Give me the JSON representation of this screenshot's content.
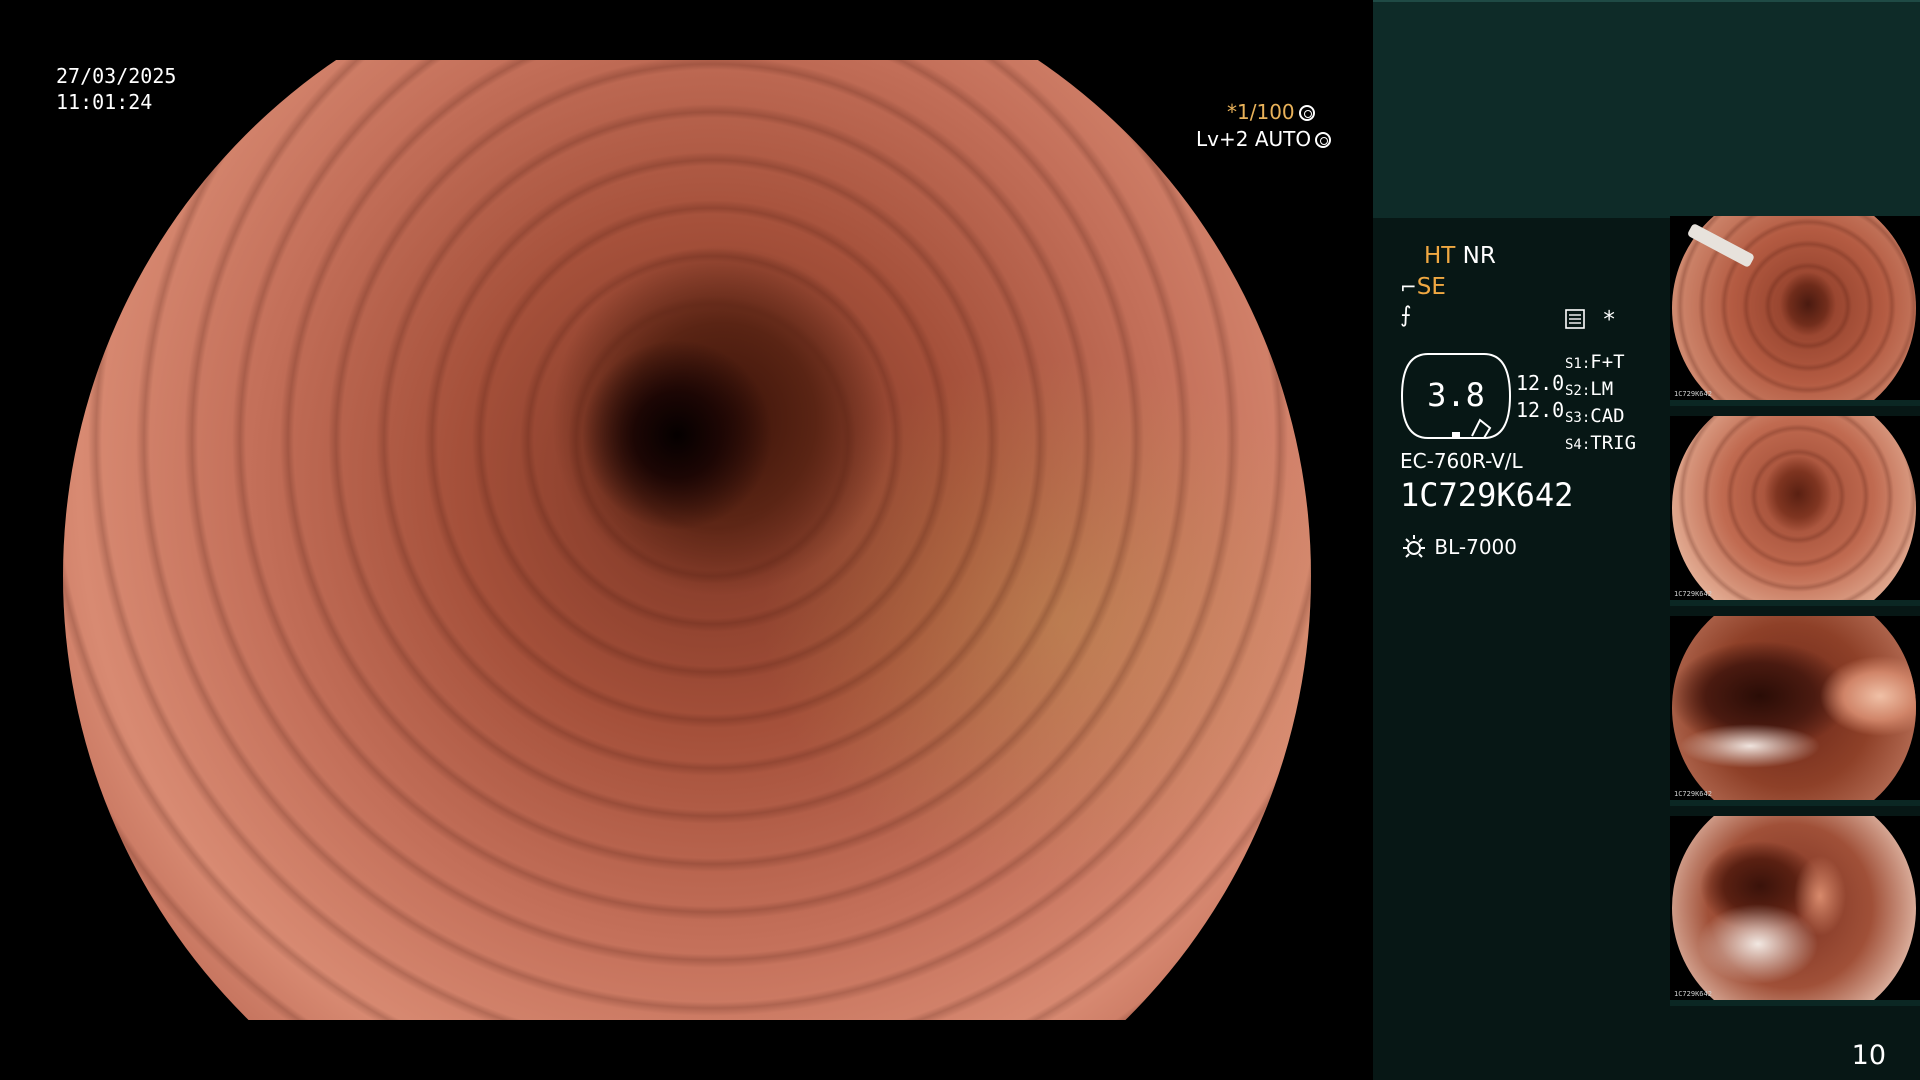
{
  "overlay": {
    "date": "27/03/2025",
    "time": "11:01:24",
    "shutter": "*1/100",
    "level": "Lv+2 AUTO"
  },
  "panel": {
    "mode_ht": "HT",
    "mode_nr": "NR",
    "mode_se": "SE",
    "star_symbol": "*",
    "gauge_value": "3.8",
    "setting_1": "12.0",
    "setting_2": "12.0",
    "presets": [
      {
        "key": "S1:",
        "value": "F+T"
      },
      {
        "key": "S2:",
        "value": "LM"
      },
      {
        "key": "S3:",
        "value": "CAD"
      },
      {
        "key": "S4:",
        "value": "TRIG"
      }
    ],
    "scope_model": "EC-760R-V/L",
    "scope_serial": "1C729K642",
    "light_source": "BL-7000",
    "page_number": "10"
  },
  "thumbnails": {
    "stamp": "1C729K642"
  },
  "colors": {
    "panel_background": "#071715",
    "panel_header": "#0e2b28",
    "accent_orange": "#f0a842"
  }
}
